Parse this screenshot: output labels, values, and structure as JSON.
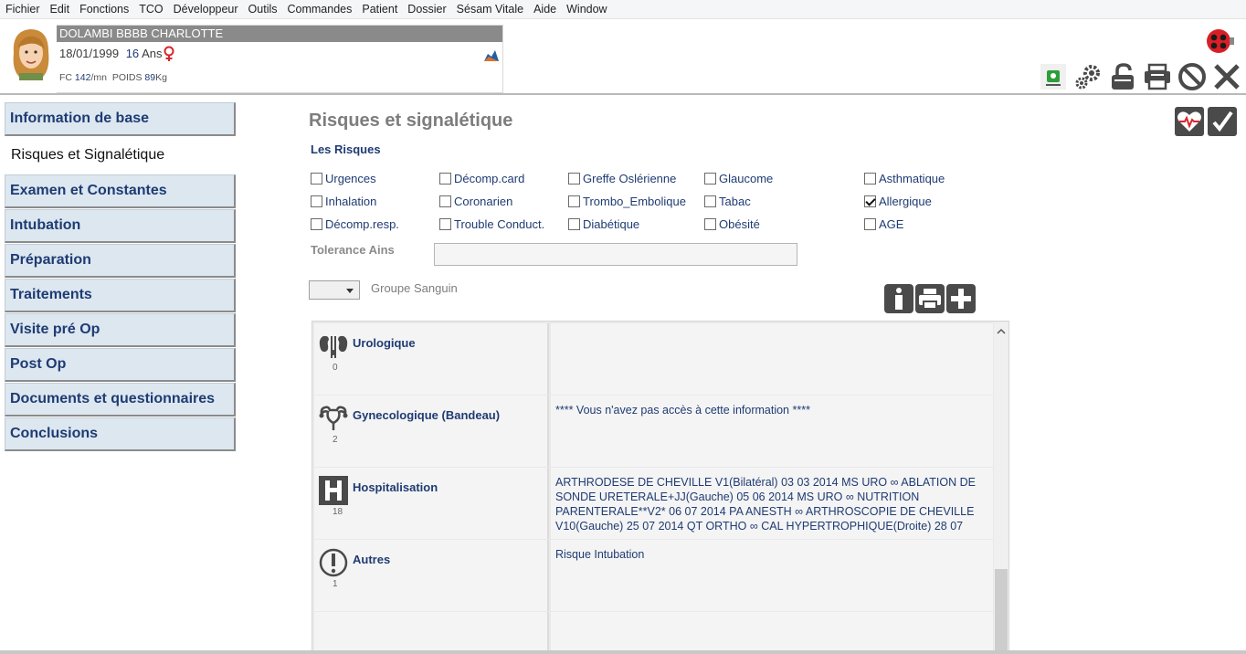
{
  "menu": [
    "Fichier",
    "Edit",
    "Fonctions",
    "TCO",
    "Développeur",
    "Outils",
    "Commandes",
    "Patient",
    "Dossier",
    "Sésam Vitale",
    "Aide",
    "Window"
  ],
  "patient": {
    "name": "DOLAMBI BBBB CHARLOTTE",
    "dob": "18/01/1999",
    "age": "16",
    "age_unit": "Ans",
    "fc_label": "FC",
    "fc_value": "142",
    "fc_unit": "/mn",
    "poids_label": "POIDS",
    "poids_value": "89",
    "poids_unit": "Kg"
  },
  "sidebar": {
    "items": [
      {
        "label": "Information de base",
        "active": false
      },
      {
        "label": "Risques et Signalétique",
        "active": true
      },
      {
        "label": "Examen et Constantes",
        "active": false
      },
      {
        "label": "Intubation",
        "active": false
      },
      {
        "label": "Préparation",
        "active": false
      },
      {
        "label": "Traitements",
        "active": false
      },
      {
        "label": "Visite pré Op",
        "active": false
      },
      {
        "label": "Post Op",
        "active": false
      },
      {
        "label": "Documents et questionnaires",
        "active": false
      },
      {
        "label": "Conclusions",
        "active": false
      }
    ]
  },
  "main": {
    "title": "Risques et signalétique",
    "risks_label": "Les Risques",
    "risks": [
      {
        "label": "Urgences",
        "checked": false
      },
      {
        "label": "Décomp.card",
        "checked": false
      },
      {
        "label": "Greffe Oslérienne",
        "checked": false
      },
      {
        "label": "Glaucome",
        "checked": false
      },
      {
        "label": "Asthmatique",
        "checked": false
      },
      {
        "label": "Inhalation",
        "checked": false
      },
      {
        "label": "Coronarien",
        "checked": false
      },
      {
        "label": "Trombo_Embolique",
        "checked": false
      },
      {
        "label": "Tabac",
        "checked": false
      },
      {
        "label": "Allergique",
        "checked": true
      },
      {
        "label": "Décomp.resp.",
        "checked": false
      },
      {
        "label": "Trouble Conduct.",
        "checked": false
      },
      {
        "label": "Diabétique",
        "checked": false
      },
      {
        "label": "Obésité",
        "checked": false
      },
      {
        "label": "AGE",
        "checked": false
      }
    ],
    "tolerance_label": "Tolerance Ains",
    "tolerance_value": "",
    "blood_group_label": "Groupe Sanguin",
    "blood_group_value": ""
  },
  "grid_rows": [
    {
      "title": "Urologique",
      "count": "0",
      "icon": "kidney-icon",
      "text": ""
    },
    {
      "title": "Gynecologique (Bandeau)",
      "count": "2",
      "icon": "uterus-icon",
      "text": "**** Vous n'avez pas accès à cette information ****"
    },
    {
      "title": "Hospitalisation",
      "count": "18",
      "icon": "hospital-icon",
      "text": "ARTHRODESE DE CHEVILLE V1(Bilatéral) 03 03 2014 MS URO ∞ ABLATION DE SONDE URETERALE+JJ(Gauche) 05 06 2014 MS URO ∞ NUTRITION PARENTERALE**V2* 06 07 2014 PA ANESTH ∞ ARTHROSCOPIE  DE CHEVILLE V10(Gauche) 25 07 2014 QT ORTHO ∞ CAL HYPERTROPHIQUE(Droite) 28 07"
    },
    {
      "title": "Autres",
      "count": "1",
      "icon": "exclamation-icon",
      "text": "Risque Intubation"
    },
    {
      "title": "",
      "count": "",
      "icon": "",
      "text": ""
    }
  ],
  "colors": {
    "accent": "#1f3b73",
    "nav_bg": "#dce7f0",
    "title_gray": "#7d7d7d"
  }
}
